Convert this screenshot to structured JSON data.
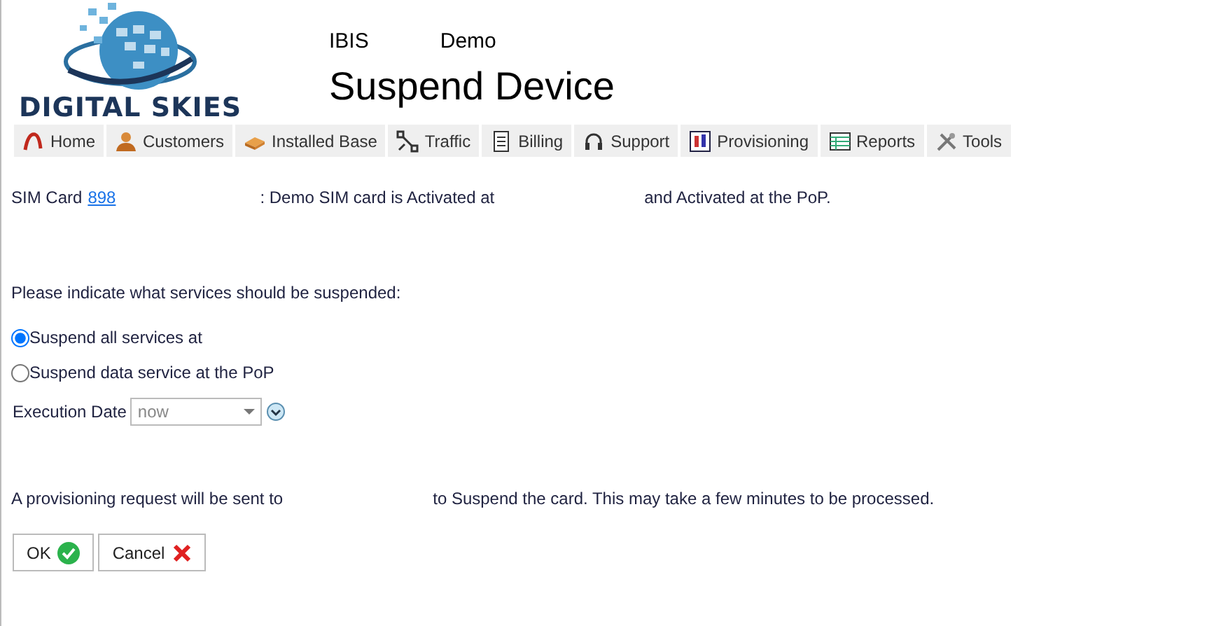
{
  "logo": {
    "text": "DIGITAL SKIES"
  },
  "header": {
    "app": "IBIS",
    "tenant": "Demo",
    "title": "Suspend Device"
  },
  "nav": [
    {
      "label": "Home"
    },
    {
      "label": "Customers"
    },
    {
      "label": "Installed Base"
    },
    {
      "label": "Traffic"
    },
    {
      "label": "Billing"
    },
    {
      "label": "Support"
    },
    {
      "label": "Provisioning"
    },
    {
      "label": "Reports"
    },
    {
      "label": "Tools"
    }
  ],
  "status": {
    "prefix": "SIM Card",
    "sim_link": "898",
    "middle": ": Demo SIM card is Activated at",
    "suffix": "and Activated at the PoP."
  },
  "instruction": "Please indicate what services should be suspended:",
  "options": [
    {
      "label": "Suspend all services at",
      "selected": true
    },
    {
      "label": "Suspend data service at the PoP",
      "selected": false
    }
  ],
  "execution": {
    "label": "Execution Date",
    "value": "now"
  },
  "notice": {
    "before": "A provisioning request will be sent to",
    "after": "to Suspend the card. This may take a few minutes to be processed."
  },
  "buttons": [
    {
      "label": "OK",
      "kind": "ok"
    },
    {
      "label": "Cancel",
      "kind": "cancel"
    }
  ]
}
